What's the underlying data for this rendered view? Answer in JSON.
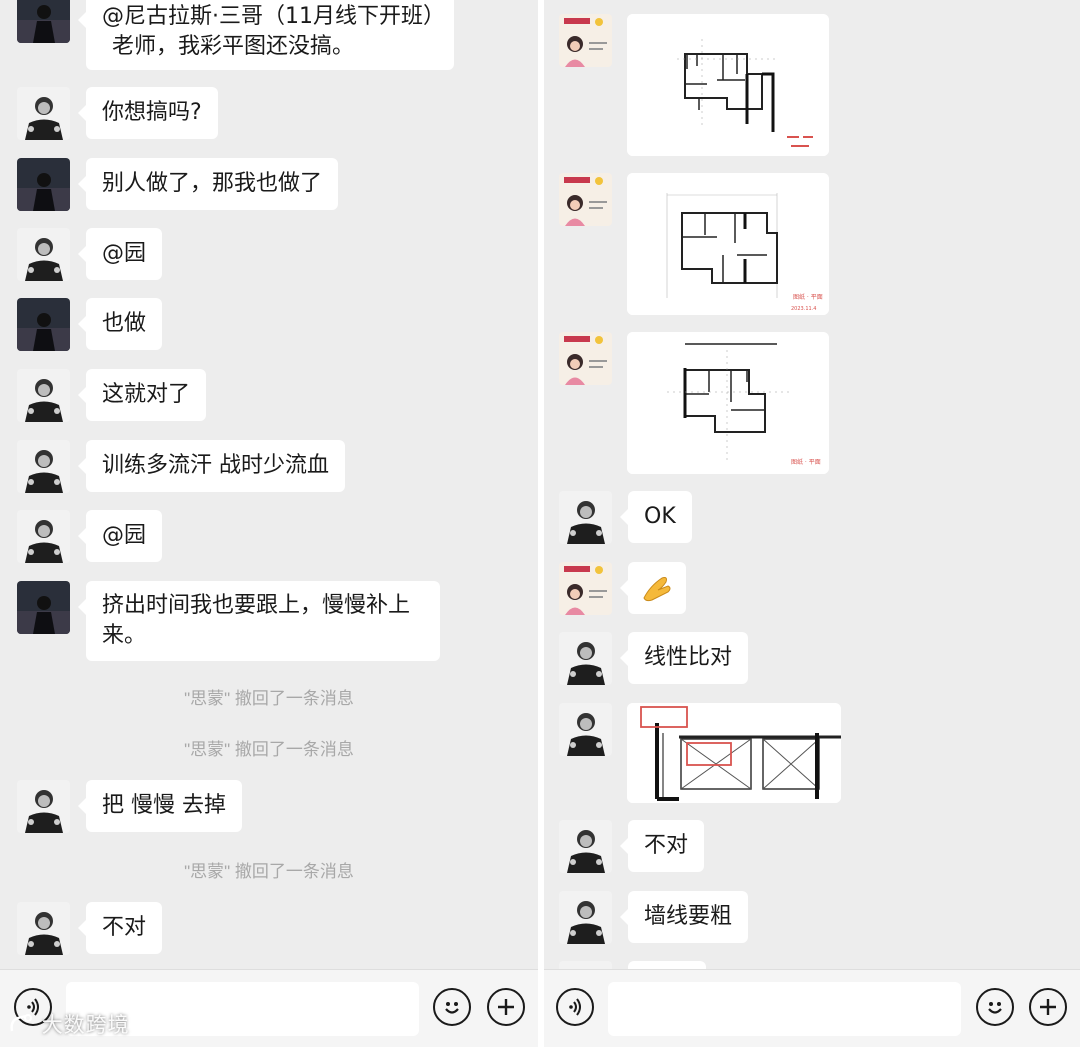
{
  "left_chat": {
    "messages": [
      {
        "sender": "sender-dark",
        "lines": [
          "@尼古拉斯·三哥（11月线下开班）",
          "老师，我彩平图还没搞。"
        ]
      },
      {
        "sender": "sender-teacher",
        "text": "你想搞吗?"
      },
      {
        "sender": "sender-dark",
        "text": "别人做了，那我也做了"
      },
      {
        "sender": "sender-teacher",
        "text": "@园"
      },
      {
        "sender": "sender-dark",
        "text": "也做"
      },
      {
        "sender": "sender-teacher",
        "text": "这就对了"
      },
      {
        "sender": "sender-teacher",
        "text": "训练多流汗 战时少流血"
      },
      {
        "sender": "sender-teacher",
        "text": "@园"
      },
      {
        "sender": "sender-dark",
        "lines": [
          "挤出时间我也要跟上，慢慢补上",
          "来。"
        ]
      },
      {
        "sender": "sender-teacher",
        "text": "把 慢慢 去掉"
      },
      {
        "sender": "sender-teacher",
        "text": "不对"
      }
    ],
    "recall_notices": [
      "\"思蒙\" 撤回了一条消息",
      "\"思蒙\" 撤回了一条消息",
      "\"思蒙\" 撤回了一条消息"
    ]
  },
  "right_chat": {
    "messages": [
      {
        "sender": "sender-poster",
        "type": "image",
        "content": "floor-plan-1"
      },
      {
        "sender": "sender-poster",
        "type": "image",
        "content": "floor-plan-2"
      },
      {
        "sender": "sender-poster",
        "type": "image",
        "content": "floor-plan-3"
      },
      {
        "sender": "sender-teacher",
        "text": "OK"
      },
      {
        "sender": "sender-poster",
        "type": "emoji",
        "content": "praying-hands-icon"
      },
      {
        "sender": "sender-teacher",
        "text": "线性比对"
      },
      {
        "sender": "sender-teacher",
        "type": "image",
        "content": "wall-line-detail"
      },
      {
        "sender": "sender-teacher",
        "text": "不对"
      },
      {
        "sender": "sender-teacher",
        "text": "墙线要粗"
      }
    ],
    "plan_captions": [
      "图纸 · 平面",
      "2023.11.4",
      "图纸 · 平面"
    ]
  },
  "input_bar": {
    "icons": [
      "voice-icon",
      "emoji-face-icon",
      "plus-icon"
    ]
  },
  "watermark": {
    "text": "大数跨境"
  },
  "colors": {
    "chat_background": "#ededed",
    "bubble": "#ffffff",
    "recall_text": "#a8a8a8",
    "annotation_red": "#d9534f"
  }
}
